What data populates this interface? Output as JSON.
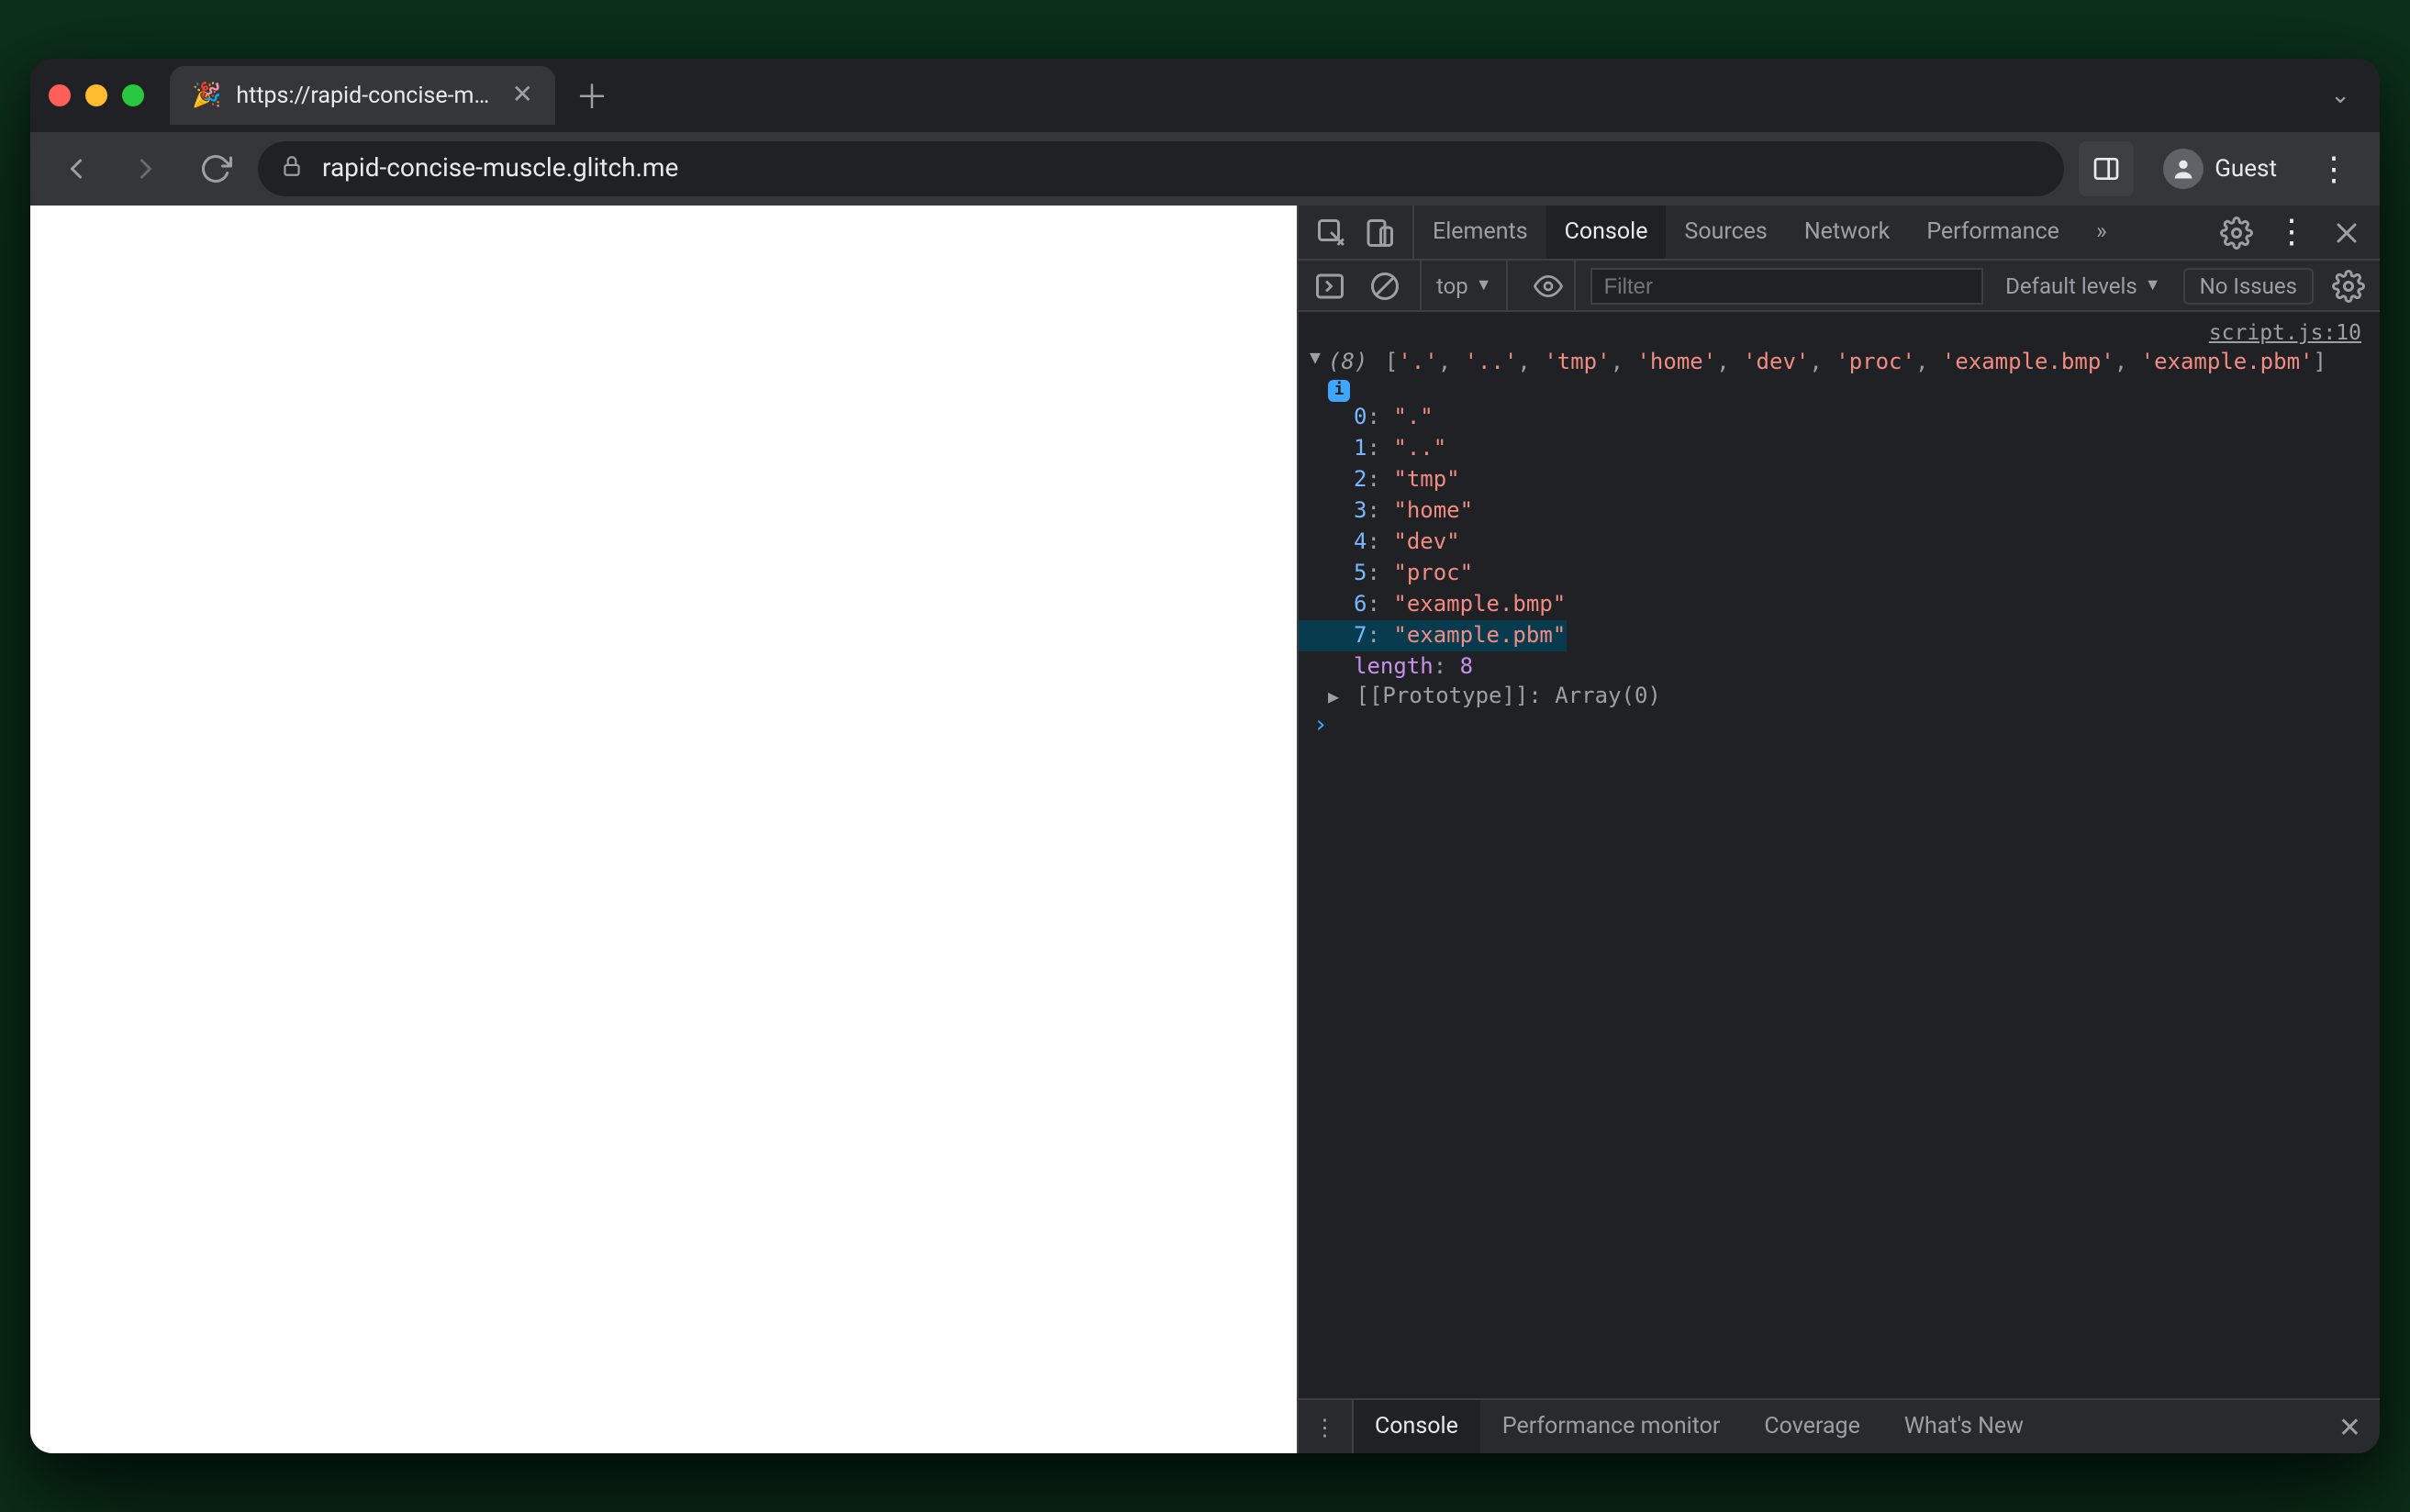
{
  "tab": {
    "favicon": "🎉",
    "title": "https://rapid-concise-muscle.g"
  },
  "address": {
    "url": "rapid-concise-muscle.glitch.me"
  },
  "profile": {
    "label": "Guest"
  },
  "devtools": {
    "tabs": [
      "Elements",
      "Console",
      "Sources",
      "Network",
      "Performance"
    ],
    "active_tab": "Console",
    "more_glyph": "»"
  },
  "console_toolbar": {
    "context": "top",
    "filter_placeholder": "Filter",
    "levels": "Default levels",
    "issues": "No Issues"
  },
  "console": {
    "source_link": "script.js:10",
    "array_count": "(8)",
    "array_preview": [
      "'.'",
      "'..'",
      "'tmp'",
      "'home'",
      "'dev'",
      "'proc'",
      "'example.bmp'",
      "'example.pbm'"
    ],
    "entries": [
      {
        "k": "0",
        "v": "\".\""
      },
      {
        "k": "1",
        "v": "\"..\""
      },
      {
        "k": "2",
        "v": "\"tmp\""
      },
      {
        "k": "3",
        "v": "\"home\""
      },
      {
        "k": "4",
        "v": "\"dev\""
      },
      {
        "k": "5",
        "v": "\"proc\""
      },
      {
        "k": "6",
        "v": "\"example.bmp\""
      },
      {
        "k": "7",
        "v": "\"example.pbm\""
      }
    ],
    "length_key": "length",
    "length_val": "8",
    "proto_label": "[[Prototype]]",
    "proto_val": "Array(0)",
    "highlight_index": 7
  },
  "drawer": {
    "tabs": [
      "Console",
      "Performance monitor",
      "Coverage",
      "What's New"
    ],
    "active": "Console"
  }
}
